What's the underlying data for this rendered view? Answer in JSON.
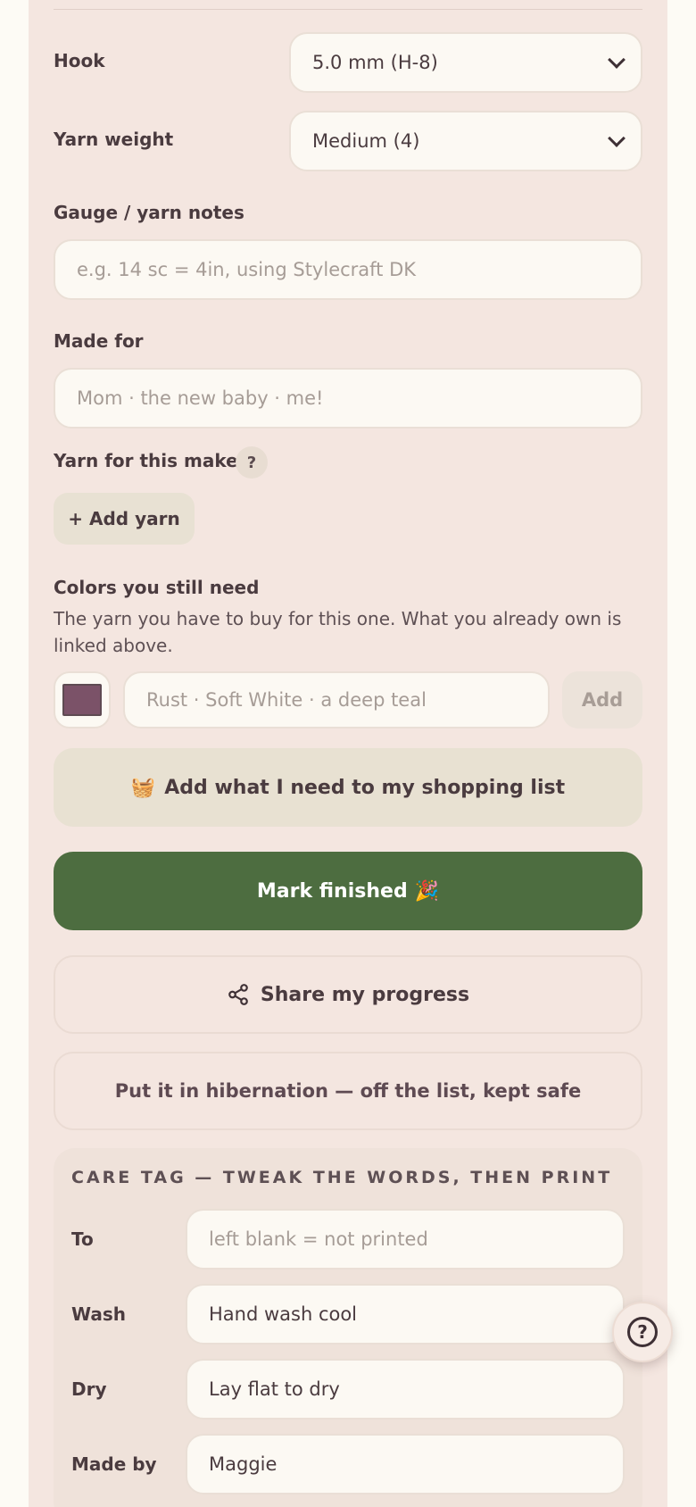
{
  "form": {
    "hook": {
      "label": "Hook",
      "value": "5.0 mm (H-8)"
    },
    "yarn_weight": {
      "label": "Yarn weight",
      "value": "Medium (4)"
    },
    "gauge": {
      "label": "Gauge / yarn notes",
      "placeholder": "e.g. 14 sc = 4in, using Stylecraft DK"
    },
    "made_for": {
      "label": "Made for",
      "placeholder": "Mom · the new baby · me!"
    },
    "yarn": {
      "label": "Yarn for this make",
      "help": "?",
      "add_label": "+ Add yarn"
    },
    "colors": {
      "label": "Colors you still need",
      "helper": "The yarn you have to buy for this one. What you already own is linked above.",
      "swatch_color": "#7b5268",
      "placeholder": "Rust · Soft White · a deep teal",
      "add_label": "Add"
    }
  },
  "actions": {
    "shopping": {
      "icon": "🧺",
      "label": "Add what I need to my shopping list"
    },
    "finish": {
      "label": "Mark finished",
      "icon": "🎉"
    },
    "share": {
      "label": "Share my progress"
    },
    "hibernate": {
      "label": "Put it in hibernation — off the list, kept safe"
    }
  },
  "care_tag": {
    "title": "CARE TAG — TWEAK THE WORDS, THEN PRINT",
    "to": {
      "label": "To",
      "placeholder": "left blank = not printed"
    },
    "wash": {
      "label": "Wash",
      "value": "Hand wash cool"
    },
    "dry": {
      "label": "Dry",
      "value": "Lay flat to dry"
    },
    "made_by": {
      "label": "Made by",
      "value": "Maggie"
    }
  },
  "fab": {
    "icon": "?"
  },
  "colors": {
    "primary_green": "#4d6d40",
    "panel": "#f4e6e0",
    "page": "#fdfbf5"
  }
}
